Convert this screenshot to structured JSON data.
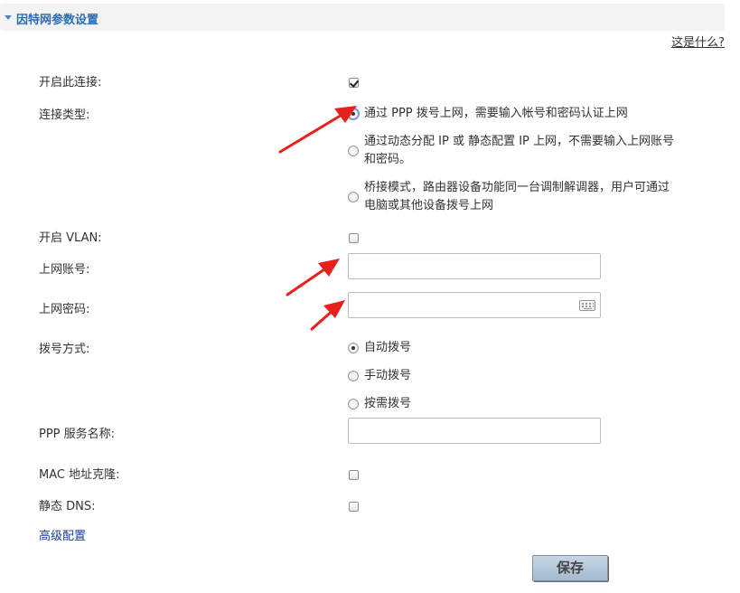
{
  "section": {
    "title": "因特网参数设置",
    "help_link": "这是什么?"
  },
  "form": {
    "enable_connection": {
      "label": "开启此连接:",
      "checked": true
    },
    "connection_type": {
      "label": "连接类型:",
      "options": [
        {
          "text": "通过 PPP 拨号上网，需要输入帐号和密码认证上网",
          "selected": true
        },
        {
          "line1": "通过动态分配 IP 或 静态配置 IP 上网，不需要输入上网账号",
          "line2": "和密码。",
          "selected": false
        },
        {
          "line1": "桥接模式，路由器设备功能同一台调制解调器，用户可通过",
          "line2": "电脑或其他设备拨号上网",
          "selected": false
        }
      ]
    },
    "enable_vlan": {
      "label": "开启 VLAN:",
      "checked": false
    },
    "account": {
      "label": "上网账号:",
      "value": ""
    },
    "password": {
      "label": "上网密码:",
      "value": ""
    },
    "dial_mode": {
      "label": "拨号方式:",
      "options": [
        {
          "text": "自动拨号",
          "selected": true
        },
        {
          "text": "手动拨号",
          "selected": false
        },
        {
          "text": "按需拨号",
          "selected": false
        }
      ]
    },
    "ppp_service": {
      "label": "PPP 服务名称:",
      "value": ""
    },
    "mac_clone": {
      "label": "MAC 地址克隆:",
      "checked": false
    },
    "static_dns": {
      "label": "静态 DNS:",
      "checked": false
    },
    "advanced_link": "高级配置",
    "save_label": "保存"
  },
  "colors": {
    "accent": "#2a6db5",
    "annotation_arrow": "#e8201c"
  }
}
